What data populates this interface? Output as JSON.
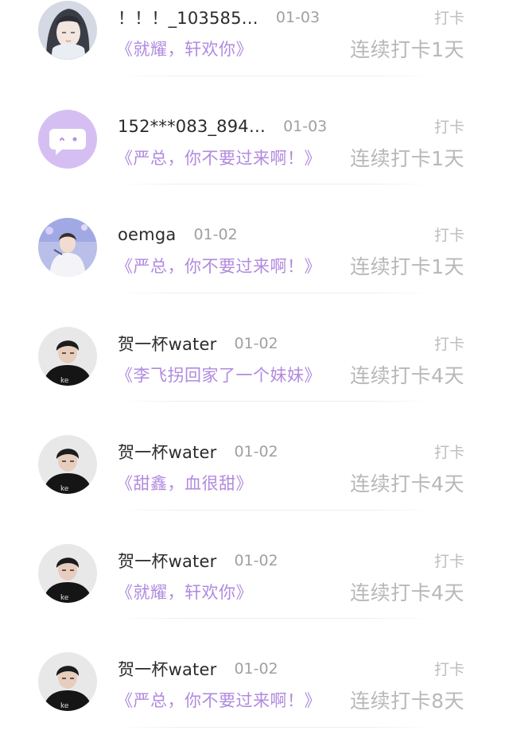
{
  "entries": [
    {
      "avatar": "anime-character-avatar",
      "username": "！！！_103585…",
      "date": "01-03",
      "book": "《就耀，轩欢你》",
      "checkin_label": "打卡",
      "streak": "连续打卡1天"
    },
    {
      "avatar": "chat-bubble-avatar",
      "username": "152***083_894…",
      "date": "01-03",
      "book": "《严总，你不要过来啊！》",
      "checkin_label": "打卡",
      "streak": "连续打卡1天"
    },
    {
      "avatar": "performer-photo-avatar",
      "username": "oemga",
      "date": "01-02",
      "book": "《严总，你不要过来啊！》",
      "checkin_label": "打卡",
      "streak": "连续打卡1天"
    },
    {
      "avatar": "person-photo-avatar",
      "username": "贺一杯water",
      "date": "01-02",
      "book": "《李飞拐回家了一个妹妹》",
      "checkin_label": "打卡",
      "streak": "连续打卡4天"
    },
    {
      "avatar": "person-photo-avatar",
      "username": "贺一杯water",
      "date": "01-02",
      "book": "《甜鑫，血很甜》",
      "checkin_label": "打卡",
      "streak": "连续打卡4天"
    },
    {
      "avatar": "person-photo-avatar",
      "username": "贺一杯water",
      "date": "01-02",
      "book": "《就耀，轩欢你》",
      "checkin_label": "打卡",
      "streak": "连续打卡4天"
    },
    {
      "avatar": "person-photo-avatar",
      "username": "贺一杯water",
      "date": "01-02",
      "book": "《严总，你不要过来啊！》",
      "checkin_label": "打卡",
      "streak": "连续打卡8天"
    }
  ],
  "colors": {
    "username": "#2b2b2b",
    "date": "#a0a0a0",
    "book_title": "#b18adf",
    "streak": "#b8b8b8",
    "checkin_label": "#bdbdbd",
    "chat_avatar_bg": "#d5bff2"
  }
}
